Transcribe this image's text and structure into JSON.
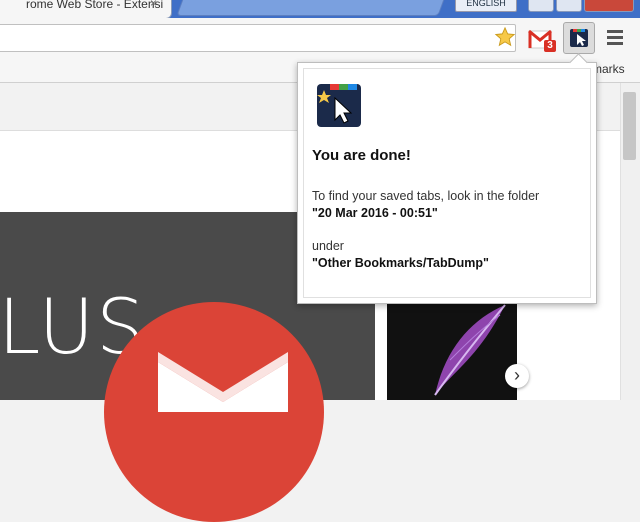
{
  "window": {
    "tab_title": "rome Web Store - Extensi",
    "tab_close": "×",
    "user_badge": "ENGLISH"
  },
  "toolbar": {
    "gmail_unread_count": "3"
  },
  "bookmarks_bar": {
    "label": "marks"
  },
  "page": {
    "hero_text": "LUS",
    "next_arrow": "›"
  },
  "popup": {
    "heading": "You are done!",
    "line1": "To find your saved tabs, look in the folder",
    "folder": "\"20 Mar 2016 - 00:51\"",
    "under": "under",
    "path": "\"Other Bookmarks/TabDump\""
  },
  "colors": {
    "title_bar": "#3f6fc7",
    "gmail_red": "#d93025",
    "hero_circle": "#db4437",
    "hero_bg": "#4a4a4a"
  },
  "icons": [
    "star-icon",
    "gmail-icon",
    "tabdump-icon",
    "menu-icon",
    "feather-icon",
    "chevron-right-icon"
  ]
}
